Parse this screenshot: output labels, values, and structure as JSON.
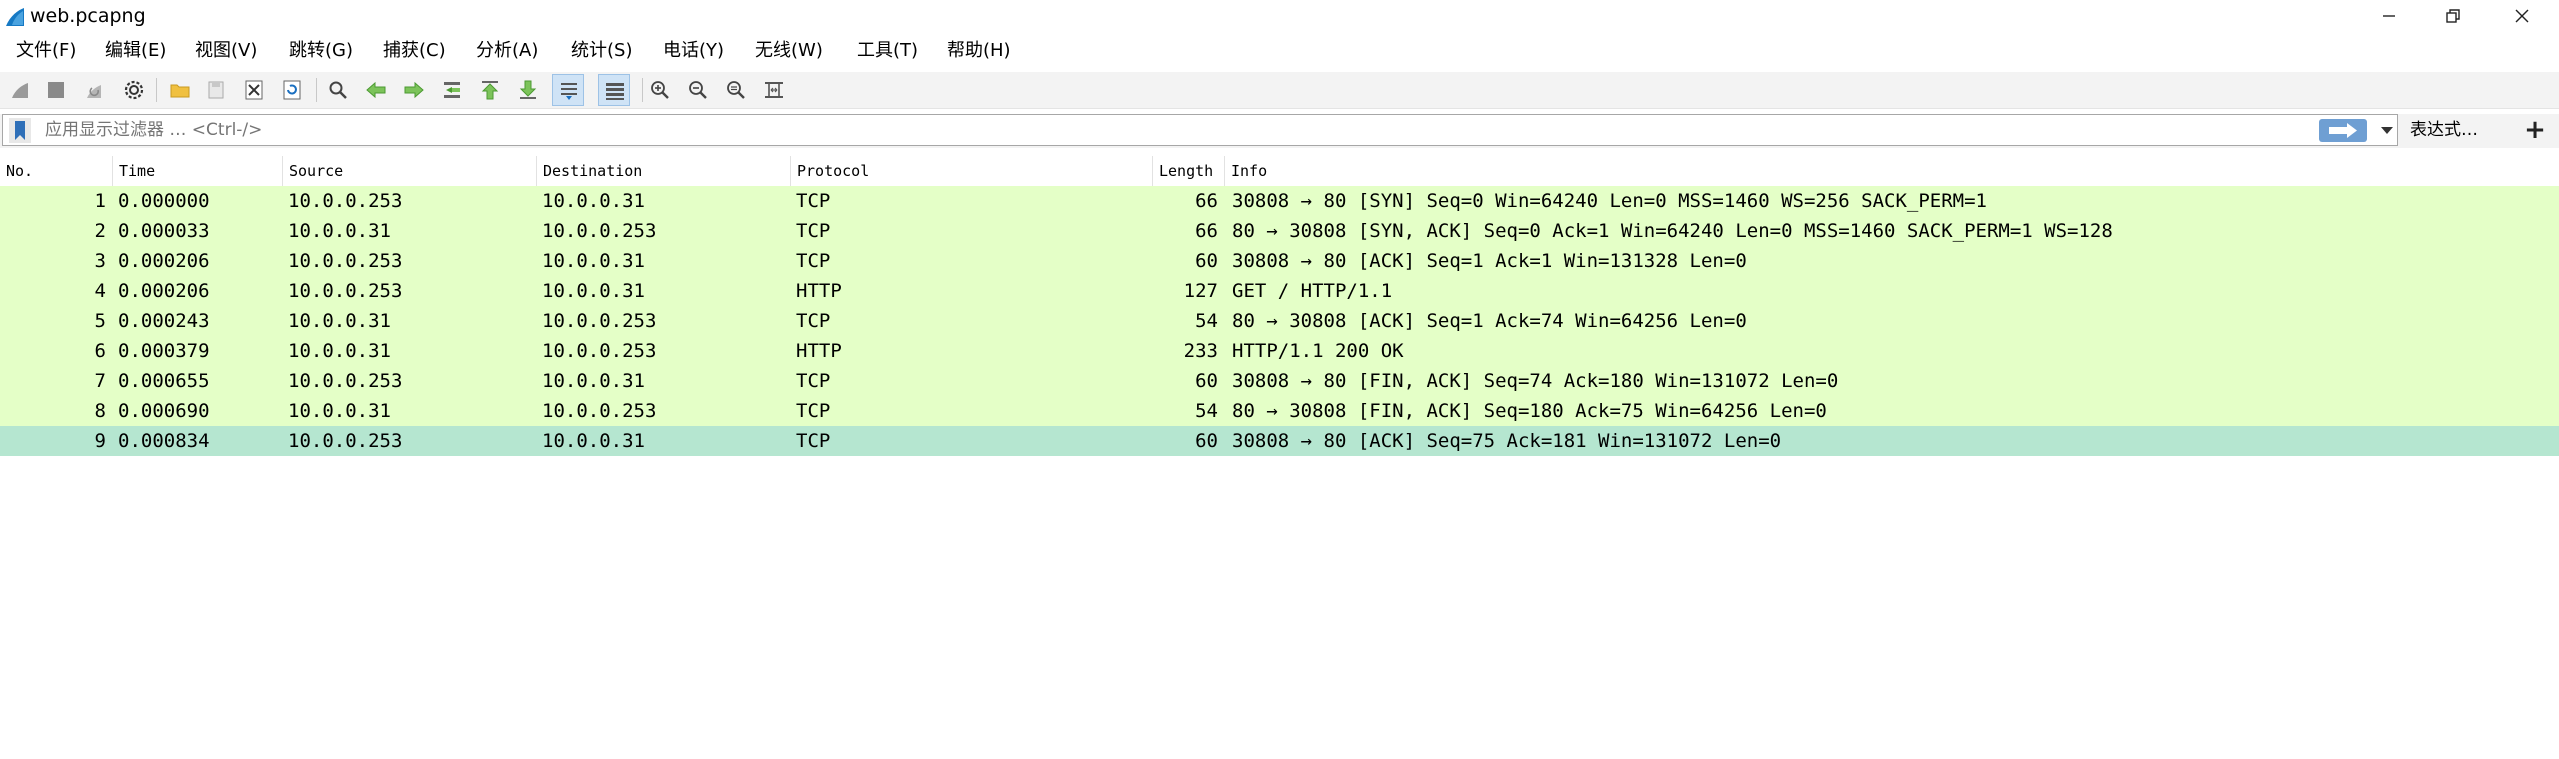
{
  "window": {
    "title": "web.pcapng",
    "minimize": "—",
    "restore": "❐",
    "close": "✕"
  },
  "menu": [
    {
      "label": "文件(F)"
    },
    {
      "label": "编辑(E)"
    },
    {
      "label": "视图(V)"
    },
    {
      "label": "跳转(G)"
    },
    {
      "label": "捕获(C)"
    },
    {
      "label": "分析(A)"
    },
    {
      "label": "统计(S)"
    },
    {
      "label": "电话(Y)"
    },
    {
      "label": "无线(W)"
    },
    {
      "label": "工具(T)"
    },
    {
      "label": "帮助(H)"
    }
  ],
  "toolbar": {
    "buttons": [
      {
        "name": "start-capture",
        "icon": "shark-fin-icon"
      },
      {
        "name": "stop-capture",
        "icon": "stop-icon"
      },
      {
        "name": "restart-capture",
        "icon": "restart-icon"
      },
      {
        "name": "capture-options",
        "icon": "gear-icon"
      },
      {
        "name": "open-file",
        "icon": "folder-icon"
      },
      {
        "name": "save-file",
        "icon": "save-icon"
      },
      {
        "name": "close-file",
        "icon": "close-file-icon"
      },
      {
        "name": "reload-file",
        "icon": "reload-icon"
      },
      {
        "name": "find-packet",
        "icon": "search-icon"
      },
      {
        "name": "go-back",
        "icon": "arrow-left-icon"
      },
      {
        "name": "go-forward",
        "icon": "arrow-right-icon"
      },
      {
        "name": "go-to-packet",
        "icon": "goto-icon"
      },
      {
        "name": "go-first",
        "icon": "arrow-up-icon"
      },
      {
        "name": "go-last",
        "icon": "arrow-down-icon"
      },
      {
        "name": "auto-scroll",
        "icon": "autoscroll-icon",
        "active": true
      },
      {
        "name": "colorize",
        "icon": "colorize-icon",
        "active": true
      },
      {
        "name": "zoom-in",
        "icon": "zoom-in-icon"
      },
      {
        "name": "zoom-out",
        "icon": "zoom-out-icon"
      },
      {
        "name": "normal-size",
        "icon": "zoom-reset-icon"
      },
      {
        "name": "resize-columns",
        "icon": "resize-columns-icon"
      }
    ]
  },
  "filter": {
    "placeholder": "应用显示过滤器 … <Ctrl-/>",
    "value": "",
    "expression_label": "表达式…",
    "add_label": "+"
  },
  "packet_list": {
    "columns": [
      "No.",
      "Time",
      "Source",
      "Destination",
      "Protocol",
      "Length",
      "Info"
    ],
    "rows": [
      {
        "no": "1",
        "time": "0.000000",
        "src": "10.0.0.253",
        "dst": "10.0.0.31",
        "proto": "TCP",
        "len": "66",
        "info": "30808 → 80 [SYN] Seq=0 Win=64240 Len=0 MSS=1460 WS=256 SACK_PERM=1"
      },
      {
        "no": "2",
        "time": "0.000033",
        "src": "10.0.0.31",
        "dst": "10.0.0.253",
        "proto": "TCP",
        "len": "66",
        "info": "80 → 30808 [SYN, ACK] Seq=0 Ack=1 Win=64240 Len=0 MSS=1460 SACK_PERM=1 WS=128"
      },
      {
        "no": "3",
        "time": "0.000206",
        "src": "10.0.0.253",
        "dst": "10.0.0.31",
        "proto": "TCP",
        "len": "60",
        "info": "30808 → 80 [ACK] Seq=1 Ack=1 Win=131328 Len=0"
      },
      {
        "no": "4",
        "time": "0.000206",
        "src": "10.0.0.253",
        "dst": "10.0.0.31",
        "proto": "HTTP",
        "len": "127",
        "info": "GET / HTTP/1.1"
      },
      {
        "no": "5",
        "time": "0.000243",
        "src": "10.0.0.31",
        "dst": "10.0.0.253",
        "proto": "TCP",
        "len": "54",
        "info": "80 → 30808 [ACK] Seq=1 Ack=74 Win=64256 Len=0"
      },
      {
        "no": "6",
        "time": "0.000379",
        "src": "10.0.0.31",
        "dst": "10.0.0.253",
        "proto": "HTTP",
        "len": "233",
        "info": "HTTP/1.1 200 OK"
      },
      {
        "no": "7",
        "time": "0.000655",
        "src": "10.0.0.253",
        "dst": "10.0.0.31",
        "proto": "TCP",
        "len": "60",
        "info": "30808 → 80 [FIN, ACK] Seq=74 Ack=180 Win=131072 Len=0"
      },
      {
        "no": "8",
        "time": "0.000690",
        "src": "10.0.0.31",
        "dst": "10.0.0.253",
        "proto": "TCP",
        "len": "54",
        "info": "80 → 30808 [FIN, ACK] Seq=180 Ack=75 Win=64256 Len=0"
      },
      {
        "no": "9",
        "time": "0.000834",
        "src": "10.0.0.253",
        "dst": "10.0.0.31",
        "proto": "TCP",
        "len": "60",
        "info": "30808 → 80 [ACK] Seq=75 Ack=181 Win=131072 Len=0",
        "selected": true
      }
    ]
  },
  "colors": {
    "row_tcp_http": "#e4ffc7",
    "row_selected": "#b5e6d0",
    "toolbar_bg": "#f3f3f3",
    "apply_button": "#6f9fd3"
  }
}
